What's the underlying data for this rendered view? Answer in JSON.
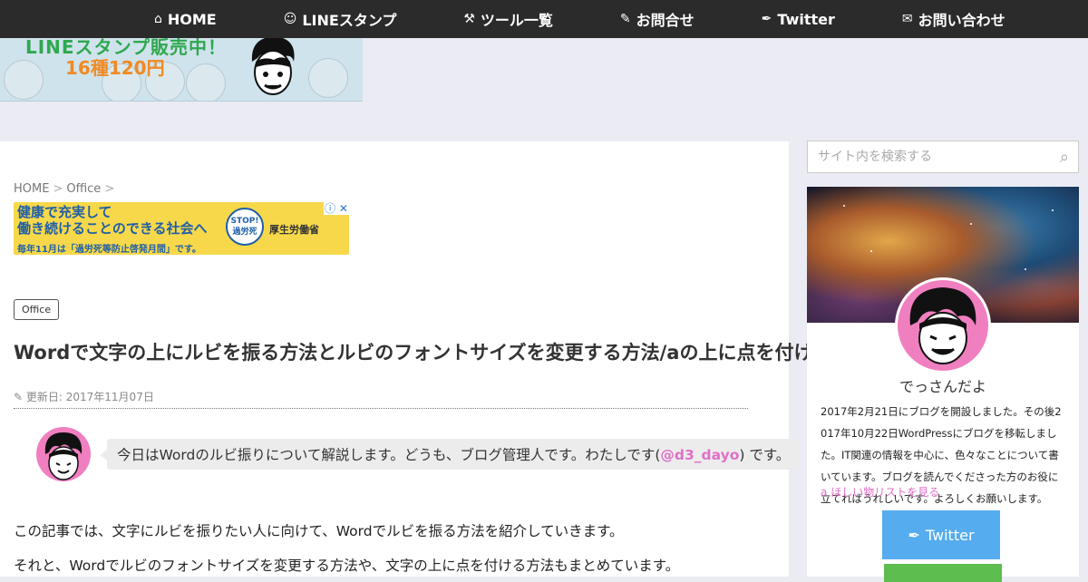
{
  "nav": {
    "items": [
      {
        "icon": "home-icon",
        "glyph": "⌂",
        "label": "HOME"
      },
      {
        "icon": "smile-icon",
        "glyph": "☺",
        "label": "LINEスタンプ"
      },
      {
        "icon": "wrench-icon",
        "glyph": "⚒",
        "label": "ツール一覧"
      },
      {
        "icon": "pencil-icon",
        "glyph": "✎",
        "label": "お問合せ"
      },
      {
        "icon": "twitter-icon",
        "glyph": "✒",
        "label": "Twitter"
      },
      {
        "icon": "envelope-icon",
        "glyph": "✉",
        "label": "お問い合わせ"
      }
    ]
  },
  "banner": {
    "line1": "LINEスタンプ販売中！",
    "line2": "16種120円"
  },
  "breadcrumb": {
    "home": "HOME",
    "sep": ">",
    "category": "Office"
  },
  "ad": {
    "line1": "健康で充実して",
    "line2": "働き続けることのできる社会へ",
    "line3": "毎年11月は「過労死等防止啓発月間」です。",
    "stop": "STOP! 過労死",
    "ministry": "厚生労働省",
    "close": "ⓘ ✕"
  },
  "post": {
    "category": "Office",
    "title": "Wordで文字の上にルビを振る方法とルビのフォントサイズを変更する方法/aの上に点を付ける方法",
    "date_icon": "✎",
    "date": "更新日: 2017年11月07日",
    "bubble_text": "今日はWordのルビ振りについて解説します。どうも、ブログ管理人です。わたしです(",
    "handle": "@d3_dayo",
    "bubble_tail": ") です。",
    "para1": "この記事では、文字にルビを振りたい人に向けて、Wordでルビを振る方法を紹介していきます。",
    "para2": "それと、Wordでルビのフォントサイズを変更する方法や、文字の上に点を付ける方法もまとめています。"
  },
  "sidebar": {
    "search_placeholder": "サイト内を検索する",
    "search_glyph": "⌕",
    "profile_name": "でっさんだよ",
    "bio": "2017年2月21日にブログを開設しました。その後2017年10月22日WordPressにブログを移転しました。IT関連の情報を中心に、色々なことについて書いています。ブログを読んでくださった方のお役に立てればうれしいです。よろしくお願いします。",
    "amazon_glyph": "a",
    "amazon_link": "ほしい物リストを見る",
    "twitter_glyph": "✒",
    "twitter_label": "Twitter"
  },
  "colors": {
    "accent": "#e070c7",
    "nav_bg": "#2b2b2b",
    "twitter": "#55acee",
    "line": "#5dbd4e"
  }
}
